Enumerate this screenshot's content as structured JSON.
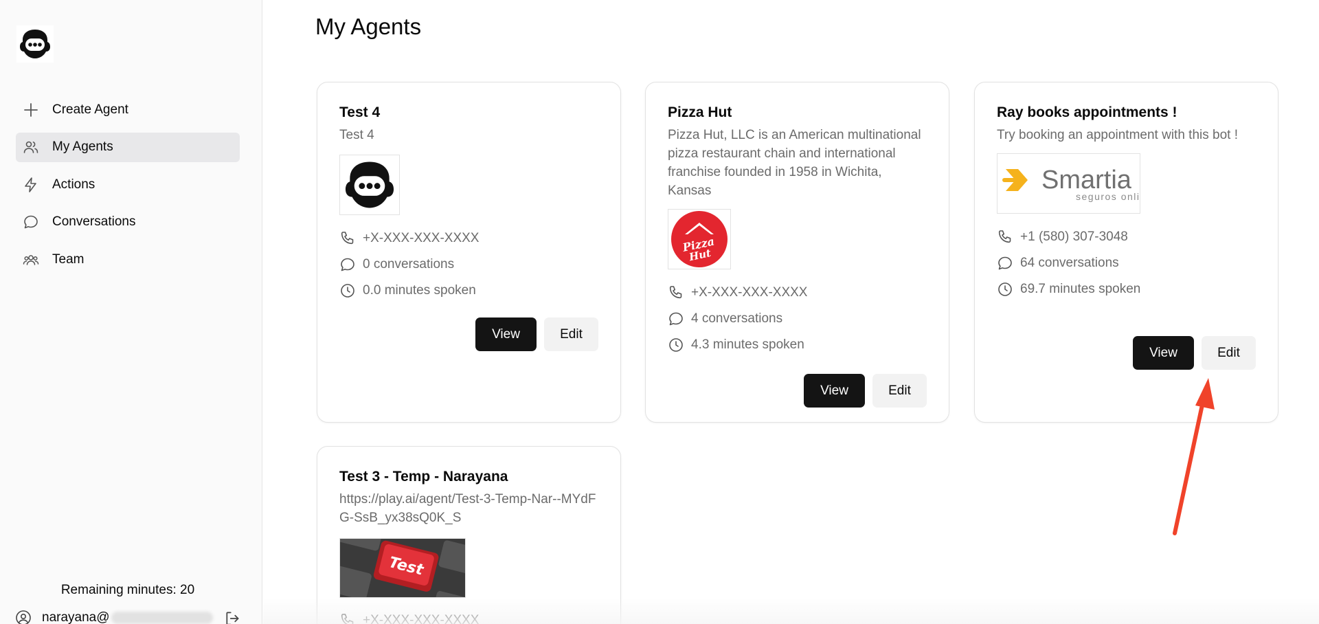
{
  "sidebar": {
    "nav": [
      {
        "label": "Create Agent",
        "icon": "plus-icon"
      },
      {
        "label": "My Agents",
        "icon": "users-icon",
        "active": true
      },
      {
        "label": "Actions",
        "icon": "lightning-icon"
      },
      {
        "label": "Conversations",
        "icon": "chat-bubble-icon"
      },
      {
        "label": "Team",
        "icon": "team-icon"
      }
    ],
    "remaining": "Remaining minutes: 20",
    "user_email": "narayana@"
  },
  "main": {
    "title": "My Agents",
    "agents": [
      {
        "name": "Test 4",
        "description": "Test 4",
        "image": "chatbot-logo",
        "phone": "+X-XXX-XXX-XXXX",
        "conversations": "0 conversations",
        "minutes": "0.0 minutes spoken",
        "view_label": "View",
        "edit_label": "Edit"
      },
      {
        "name": "Pizza Hut",
        "description": "Pizza Hut, LLC is an American multinational pizza restaurant chain and international franchise founded in 1958 in Wichita, Kansas",
        "image": "pizza-hut-logo",
        "image_text": "Pizza Hut",
        "phone": "+X-XXX-XXX-XXXX",
        "conversations": "4 conversations",
        "minutes": "4.3 minutes spoken",
        "view_label": "View",
        "edit_label": "Edit"
      },
      {
        "name": "Ray books appointments !",
        "description": "Try booking an appointment with this bot !",
        "image": "smartia-logo",
        "image_text": "Smartia",
        "image_subtext": "seguros online",
        "phone": "+1 (580) 307-3048",
        "conversations": "64 conversations",
        "minutes": "69.7 minutes spoken",
        "view_label": "View",
        "edit_label": "Edit"
      },
      {
        "name": "Test 3 - Temp - Narayana",
        "description": "https://play.ai/agent/Test-3-Temp-Nar--MYdFG-SsB_yx38sQ0K_S",
        "image": "test-key-photo",
        "image_text": "Test",
        "phone": "+X-XXX-XXX-XXXX"
      }
    ]
  },
  "colors": {
    "accent_button": "#141414",
    "annotation_arrow": "#f0432a"
  }
}
